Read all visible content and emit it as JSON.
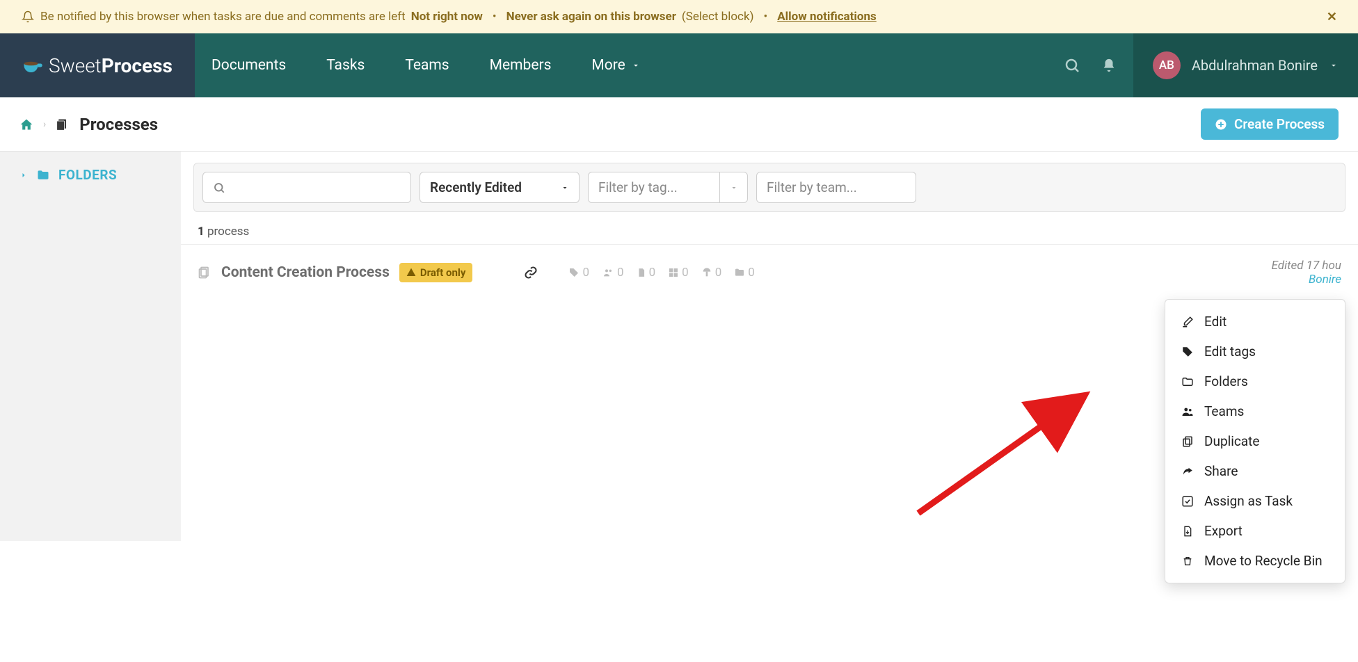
{
  "notification": {
    "text": "Be notified by this browser when tasks are due and comments are left",
    "not_now": "Not right now",
    "never_ask": "Never ask again on this browser",
    "select_block": "(Select block)",
    "allow": "Allow notifications"
  },
  "brand": {
    "sweet": "Sweet",
    "process": "Process"
  },
  "nav": {
    "documents": "Documents",
    "tasks": "Tasks",
    "teams": "Teams",
    "members": "Members",
    "more": "More"
  },
  "user": {
    "initials": "AB",
    "name": "Abdulrahman Bonire"
  },
  "breadcrumb": {
    "title": "Processes"
  },
  "create_button": "Create Process",
  "sidebar": {
    "folders": "FOLDERS"
  },
  "filters": {
    "sort": "Recently Edited",
    "tag_placeholder": "Filter by tag...",
    "team_placeholder": "Filter by team..."
  },
  "count": {
    "n": "1",
    "label": "process"
  },
  "row": {
    "title": "Content Creation Process",
    "badge": "Draft only",
    "stats": {
      "tags": "0",
      "members": "0",
      "docs": "0",
      "procs": "0",
      "tasks": "0",
      "folders": "0"
    },
    "edited": "Edited 17 hou",
    "author": "Bonire"
  },
  "menu": {
    "edit": "Edit",
    "edit_tags": "Edit tags",
    "folders": "Folders",
    "teams": "Teams",
    "duplicate": "Duplicate",
    "share": "Share",
    "assign": "Assign as Task",
    "export": "Export",
    "recycle": "Move to Recycle Bin"
  }
}
